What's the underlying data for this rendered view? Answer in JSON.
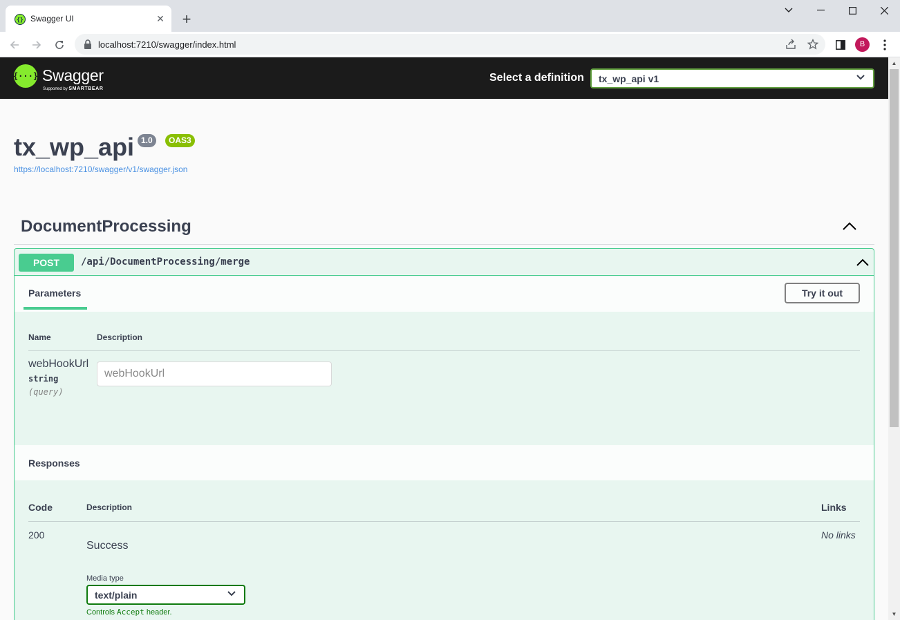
{
  "browser": {
    "tab_title": "Swagger UI",
    "url": "localhost:7210/swagger/index.html",
    "profile_initial": "B"
  },
  "swagger": {
    "brand": "Swagger",
    "supported_by": "Supported by",
    "smartbear": "SMARTBEAR",
    "select_label": "Select a definition",
    "selected_definition": "tx_wp_api v1"
  },
  "info": {
    "title": "tx_wp_api",
    "version": "1.0",
    "oas": "OAS3",
    "spec_url": "https://localhost:7210/swagger/v1/swagger.json"
  },
  "tag": {
    "name": "DocumentProcessing"
  },
  "operation": {
    "method": "POST",
    "path": "/api/DocumentProcessing/merge",
    "parameters_tab": "Parameters",
    "try_button": "Try it out",
    "param_headers": {
      "name": "Name",
      "description": "Description"
    },
    "parameter": {
      "name": "webHookUrl",
      "type": "string",
      "in": "(query)",
      "placeholder": "webHookUrl"
    },
    "responses_title": "Responses",
    "response_headers": {
      "code": "Code",
      "description": "Description",
      "links": "Links"
    },
    "response": {
      "code": "200",
      "description": "Success",
      "links": "No links",
      "media_type_label": "Media type",
      "media_type": "text/plain",
      "controls_prefix": "Controls ",
      "controls_code": "Accept",
      "controls_suffix": " header."
    }
  },
  "colors": {
    "post": "#49cc90",
    "topbar": "#1b1b1b",
    "logo": "#85ea2d",
    "oas_badge": "#89bf04",
    "version_badge": "#7d8492",
    "link": "#4990e2"
  }
}
